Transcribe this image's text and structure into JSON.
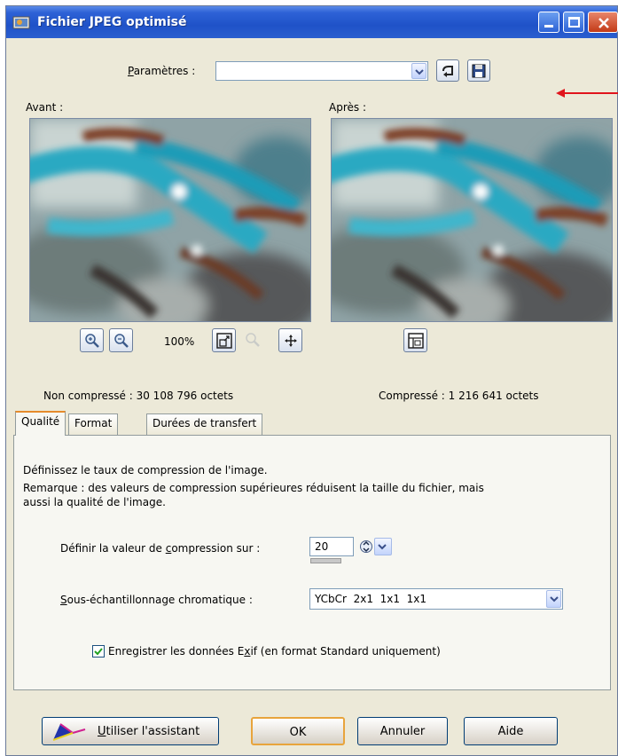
{
  "window": {
    "title": "Fichier JPEG optimisé"
  },
  "settings": {
    "label_prefix": "P",
    "label_rest": "aramètres :",
    "value": ""
  },
  "preview": {
    "before_label": "Avant :",
    "after_label": "Après :",
    "zoom_level": "100%",
    "uncompressed_label": "Non compressé : 30 108 796 octets",
    "compressed_label": "Compressé : 1 216 641 octets"
  },
  "tabs": [
    {
      "label": "Qualité"
    },
    {
      "label": "Format"
    },
    {
      "label": "Durées de transfert"
    }
  ],
  "quality": {
    "description": "Définissez le taux de compression de l'image.",
    "note_line1": "Remarque : des valeurs de compression supérieures réduisent la taille du fichier, mais",
    "note_line2": "aussi la qualité de l'image.",
    "compression_label_a": "Définir la valeur de ",
    "compression_label_u": "c",
    "compression_label_b": "ompression sur :",
    "compression_value": "20",
    "chroma_label_u": "S",
    "chroma_label_rest": "ous-échantillonnage chromatique :",
    "chroma_value": "YCbCr  2x1  1x1  1x1",
    "exif_label_a": "Enregistrer les données E",
    "exif_label_u": "x",
    "exif_label_b": "if (en format Standard uniquement)",
    "exif_checked": true
  },
  "buttons": {
    "wizard_u": "U",
    "wizard_rest": "tiliser l'assistant",
    "ok": "OK",
    "cancel": "Annuler",
    "help": "Aide"
  },
  "colors": {
    "titlebar": "#1f52c8",
    "annotation_arrow": "#e0141c",
    "tab_highlight": "#e68b2c"
  }
}
